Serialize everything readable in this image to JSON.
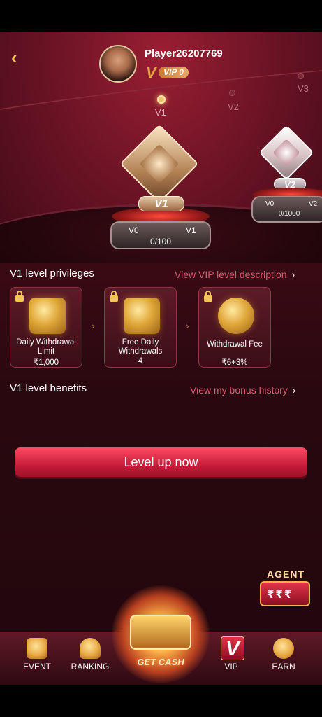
{
  "header": {
    "player_name": "Player26207769",
    "vip_mark": "V",
    "vip_label": "VIP 0"
  },
  "levels": {
    "track": [
      "V1",
      "V2",
      "V3"
    ],
    "current": {
      "plate": "V1",
      "range_start": "V0",
      "range_end": "V1",
      "progress": "0/100"
    },
    "next": {
      "plate": "V2",
      "range_start": "V0",
      "range_end": "V2",
      "progress": "0/1000"
    }
  },
  "privileges": {
    "title": "V1 level privileges",
    "link": "View VIP level description",
    "chevron": "›",
    "cards": [
      {
        "name": "Daily Withdrawal Limit",
        "value": "₹1,000",
        "icon": "safe-icon"
      },
      {
        "name": "Free Daily Withdrawals",
        "value": "4",
        "icon": "wallet-icon"
      },
      {
        "name": "Withdrawal Fee",
        "value": "₹6+3%",
        "icon": "piggy-bank-icon"
      }
    ],
    "separator": "›"
  },
  "benefits": {
    "title": "V1 level benefits",
    "link": "View my bonus history"
  },
  "actions": {
    "level_up": "Level up now"
  },
  "agent": {
    "label": "AGENT",
    "reels": "₹₹₹"
  },
  "nav": {
    "items": [
      {
        "label": "EVENT",
        "icon": "gift-icon"
      },
      {
        "label": "RANKING",
        "icon": "trophy-icon"
      },
      {
        "label": "GET CASH",
        "icon": "treasure-chest-icon"
      },
      {
        "label": "VIP",
        "icon": "vip-icon"
      },
      {
        "label": "EARN",
        "icon": "rupee-coin-icon"
      }
    ],
    "vip_mark": "V"
  },
  "colors": {
    "accent_gold": "#f2c25a",
    "accent_red": "#c81d3a",
    "link_pink": "#d65e73",
    "background": "#3a0a14"
  }
}
